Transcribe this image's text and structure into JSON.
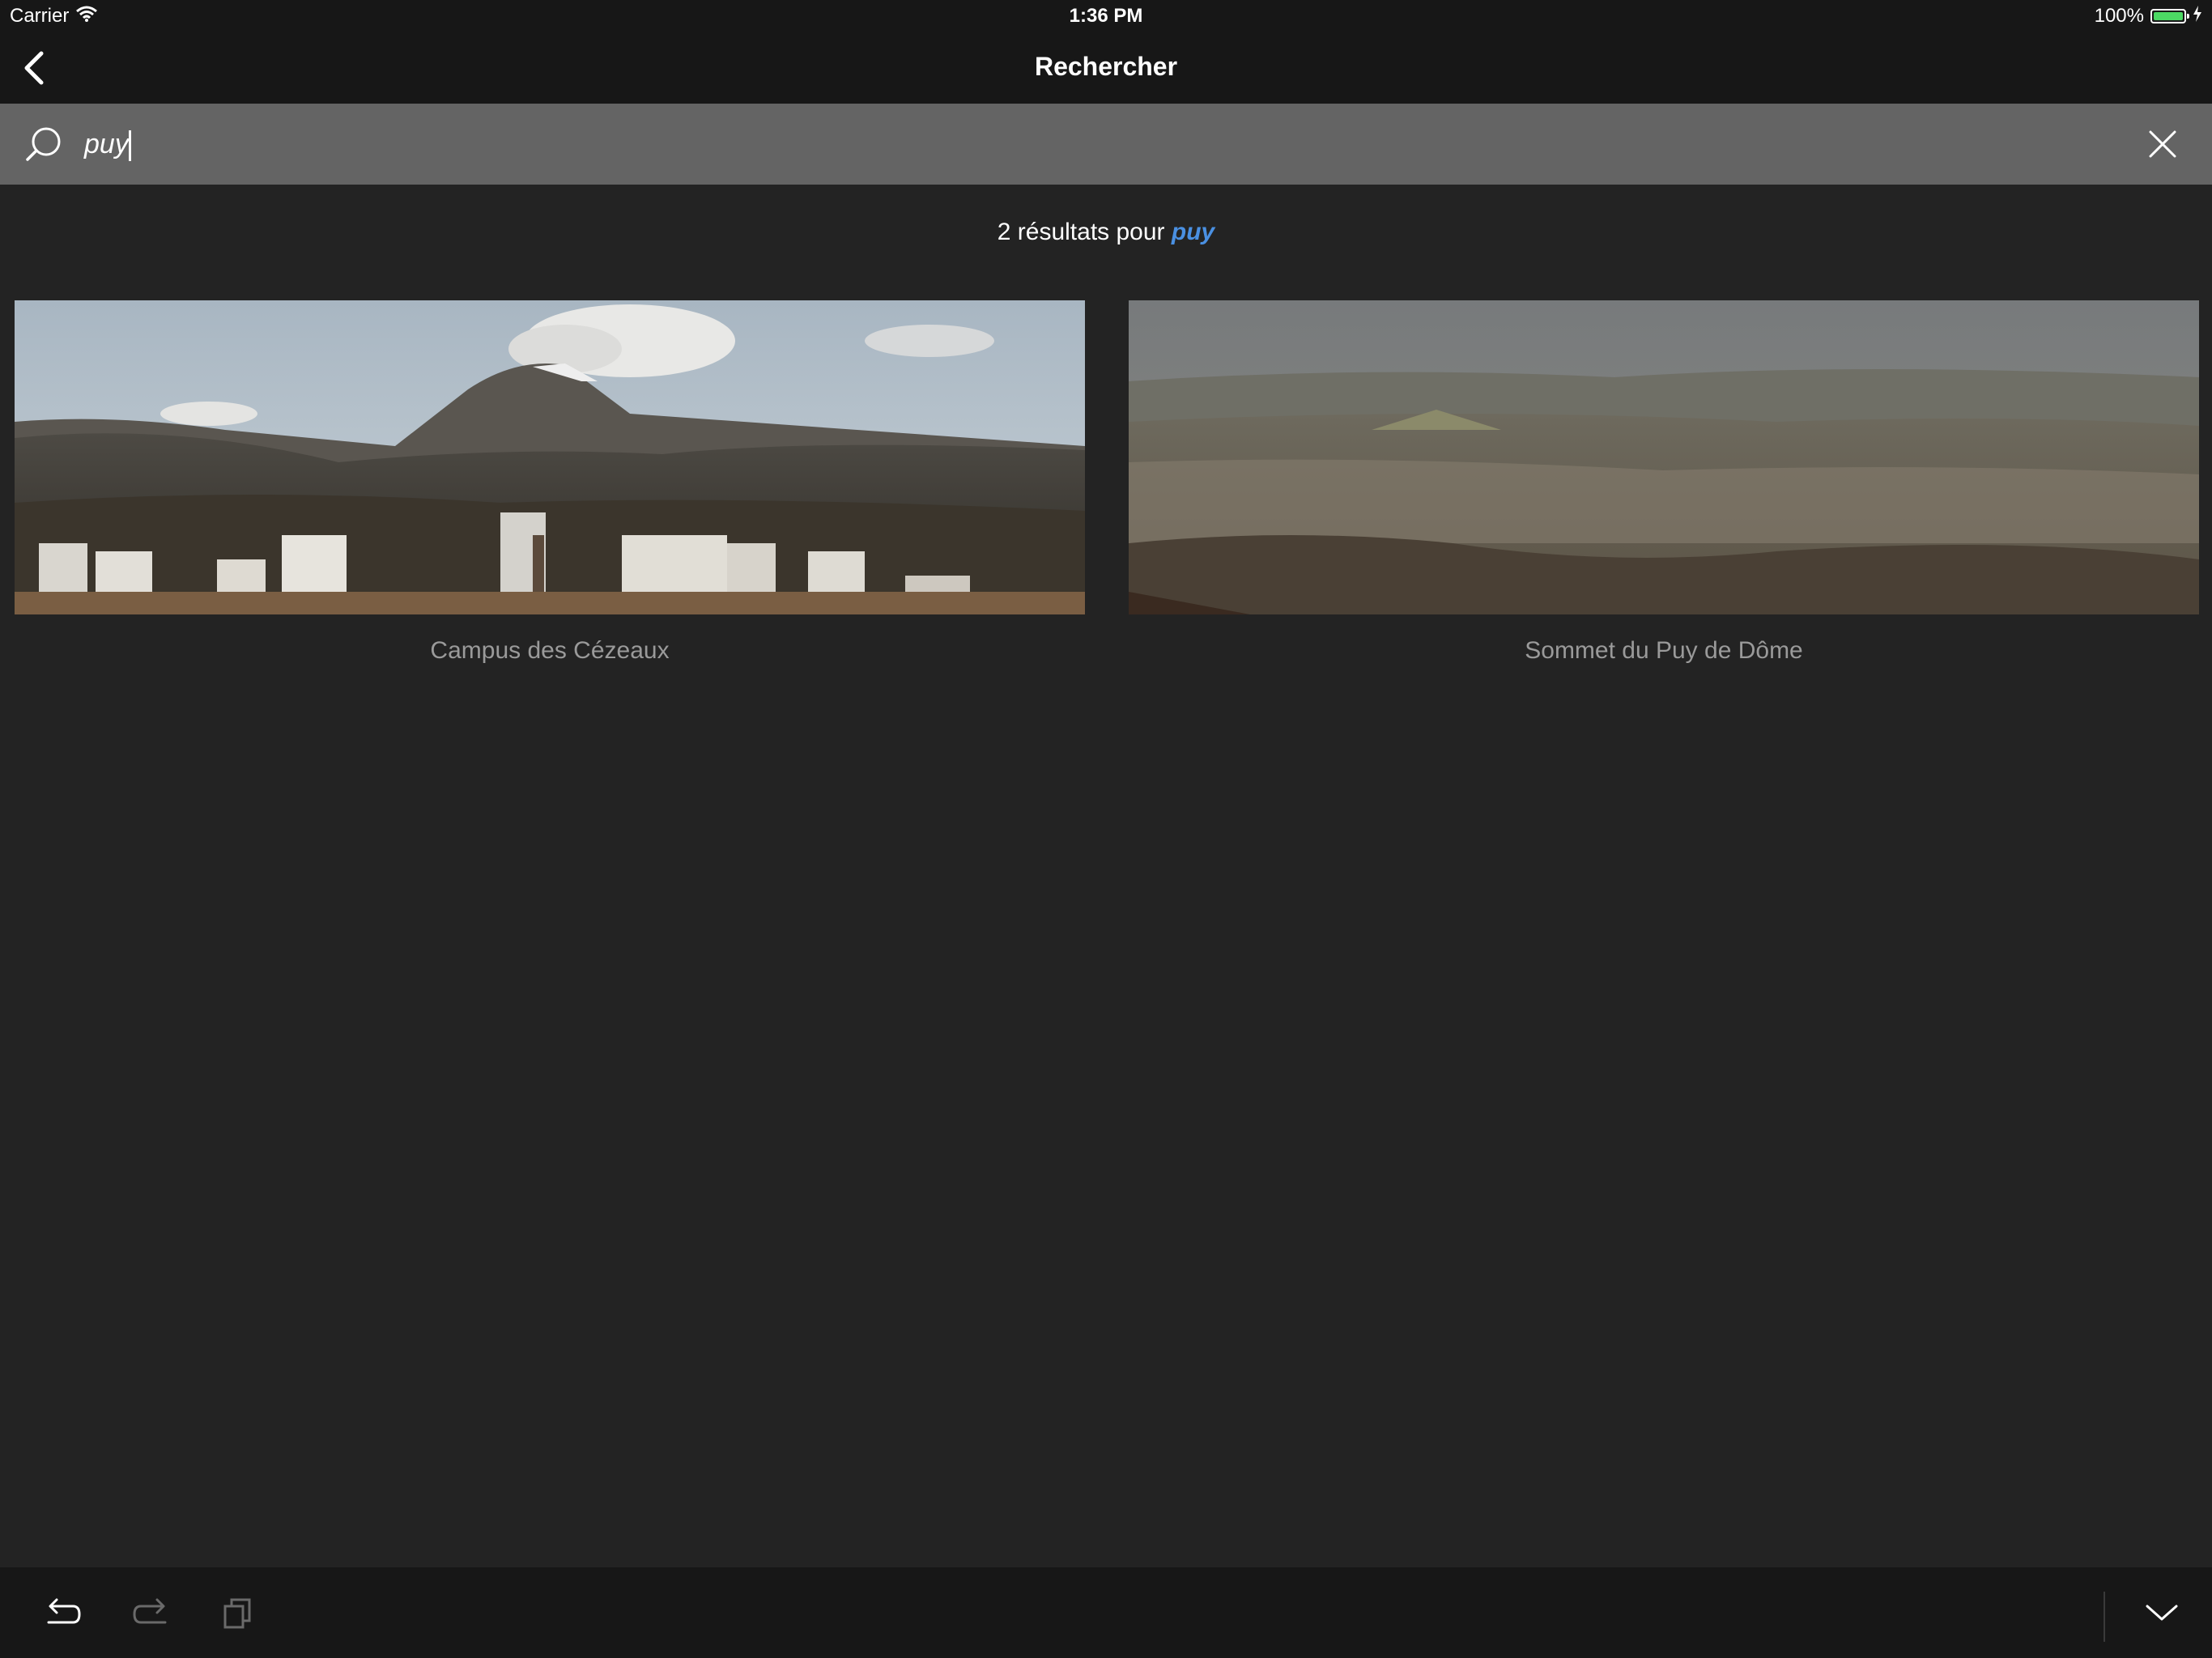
{
  "status_bar": {
    "carrier": "Carrier",
    "time": "1:36 PM",
    "battery_text": "100%",
    "battery_level": 1.0,
    "icons": [
      "wifi-icon",
      "battery-icon",
      "charging-icon"
    ]
  },
  "nav": {
    "title": "Rechercher",
    "back_icon": "chevron-left-icon"
  },
  "search": {
    "value": "puy",
    "icon": "search-icon",
    "clear_icon": "close-icon"
  },
  "results": {
    "count_prefix": "2 résultats pour ",
    "query": "puy",
    "items": [
      {
        "caption": "Campus des Cézeaux"
      },
      {
        "caption": "Sommet du Puy de Dôme"
      }
    ]
  },
  "toolbar": {
    "icons": [
      "undo-icon",
      "redo-icon",
      "copy-icon",
      "chevron-down-icon"
    ]
  },
  "colors": {
    "background": "#232323",
    "bars": "#171717",
    "search_bg": "#646464",
    "accent": "#4a90e2",
    "caption": "#9a9a9a",
    "battery": "#4cd964"
  }
}
